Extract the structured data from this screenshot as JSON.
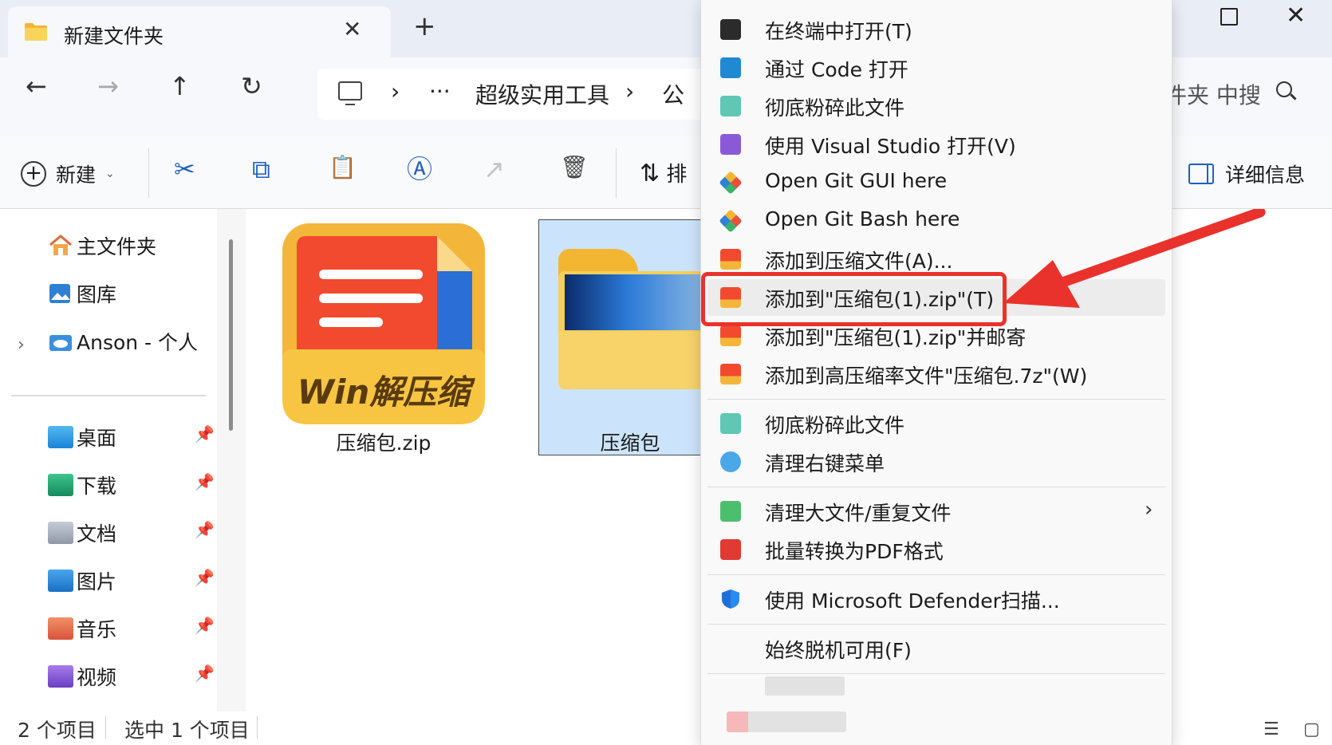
{
  "window": {
    "tab_title": "新建文件夹",
    "tab_close": "✕",
    "new_tab": "+",
    "maximize_label": "",
    "close": "✕"
  },
  "nav": {
    "back": "←",
    "forward": "→",
    "up": "↑",
    "refresh": "↻",
    "breadcrumb": [
      "›",
      "···",
      "超级实用工具",
      "›",
      "公"
    ],
    "search_placeholder_partial": "件夹 中搜"
  },
  "toolbar": {
    "new_label": "新建",
    "new_caret": "⌄",
    "cut_icon": "✂",
    "copy_icon": "⧉",
    "paste_icon": "📋",
    "rename_icon": "Ⓐ",
    "share_icon": "↗",
    "delete_icon": "🗑",
    "sort_label": "排",
    "sort_icon": "⇅",
    "details_label": "详细信息"
  },
  "sidebar": {
    "top_items": [
      {
        "label": "主文件夹",
        "icon": "home-icon"
      },
      {
        "label": "图库",
        "icon": "gallery-icon"
      },
      {
        "label": "Anson - 个人",
        "icon": "onedrive-icon"
      }
    ],
    "expand_chevron": "›",
    "quick_access": [
      {
        "label": "桌面",
        "icon": "desktop-folder-icon"
      },
      {
        "label": "下载",
        "icon": "downloads-folder-icon"
      },
      {
        "label": "文档",
        "icon": "documents-folder-icon"
      },
      {
        "label": "图片",
        "icon": "pictures-folder-icon"
      },
      {
        "label": "音乐",
        "icon": "music-folder-icon"
      },
      {
        "label": "视频",
        "icon": "videos-folder-icon"
      }
    ],
    "pin_glyph": "📌"
  },
  "content": {
    "files": [
      {
        "name": "压缩包.zip",
        "icon": "win-zip-archive-icon",
        "icon_text": "Win解压缩"
      },
      {
        "name": "压缩包",
        "icon": "folder-icon",
        "selected": true
      }
    ]
  },
  "status": {
    "count": "2 个项目",
    "selected": "选中 1 个项目",
    "view_list": "☰",
    "view_tiles": "▢"
  },
  "context_menu": {
    "groups": [
      [
        {
          "label": "在终端中打开(T)",
          "icon": "terminal-icon"
        },
        {
          "label": "通过 Code 打开",
          "icon": "vscode-icon"
        },
        {
          "label": "彻底粉碎此文件",
          "icon": "shredder-icon"
        },
        {
          "label": "使用 Visual Studio 打开(V)",
          "icon": "visual-studio-icon"
        },
        {
          "label": "Open Git GUI here",
          "icon": "git-gui-icon"
        },
        {
          "label": "Open Git Bash here",
          "icon": "git-bash-icon"
        },
        {
          "label": "添加到压缩文件(A)...",
          "icon": "archive-add-icon"
        },
        {
          "label": "添加到\"压缩包(1).zip\"(T)",
          "icon": "archive-add-icon",
          "highlighted": true
        },
        {
          "label": "添加到\"压缩包(1).zip\"并邮寄",
          "icon": "archive-mail-icon"
        },
        {
          "label": "添加到高压缩率文件\"压缩包.7z\"(W)",
          "icon": "archive-7z-icon"
        }
      ],
      [
        {
          "label": "彻底粉碎此文件",
          "icon": "shredder-icon"
        },
        {
          "label": "清理右键菜单",
          "icon": "mouse-clean-icon"
        }
      ],
      [
        {
          "label": "清理大文件/重复文件",
          "icon": "broom-icon",
          "submenu": "›"
        },
        {
          "label": "批量转换为PDF格式",
          "icon": "pdf-icon"
        }
      ],
      [
        {
          "label": "使用 Microsoft Defender扫描...",
          "icon": "defender-shield-icon"
        }
      ],
      [
        {
          "label": "始终脱机可用(F)",
          "icon": ""
        }
      ]
    ]
  },
  "colors": {
    "accent": "#1f5fbf",
    "highlight_red": "#e9322c",
    "selection": "#cce4fb",
    "titlebar": "#e9eef6"
  }
}
